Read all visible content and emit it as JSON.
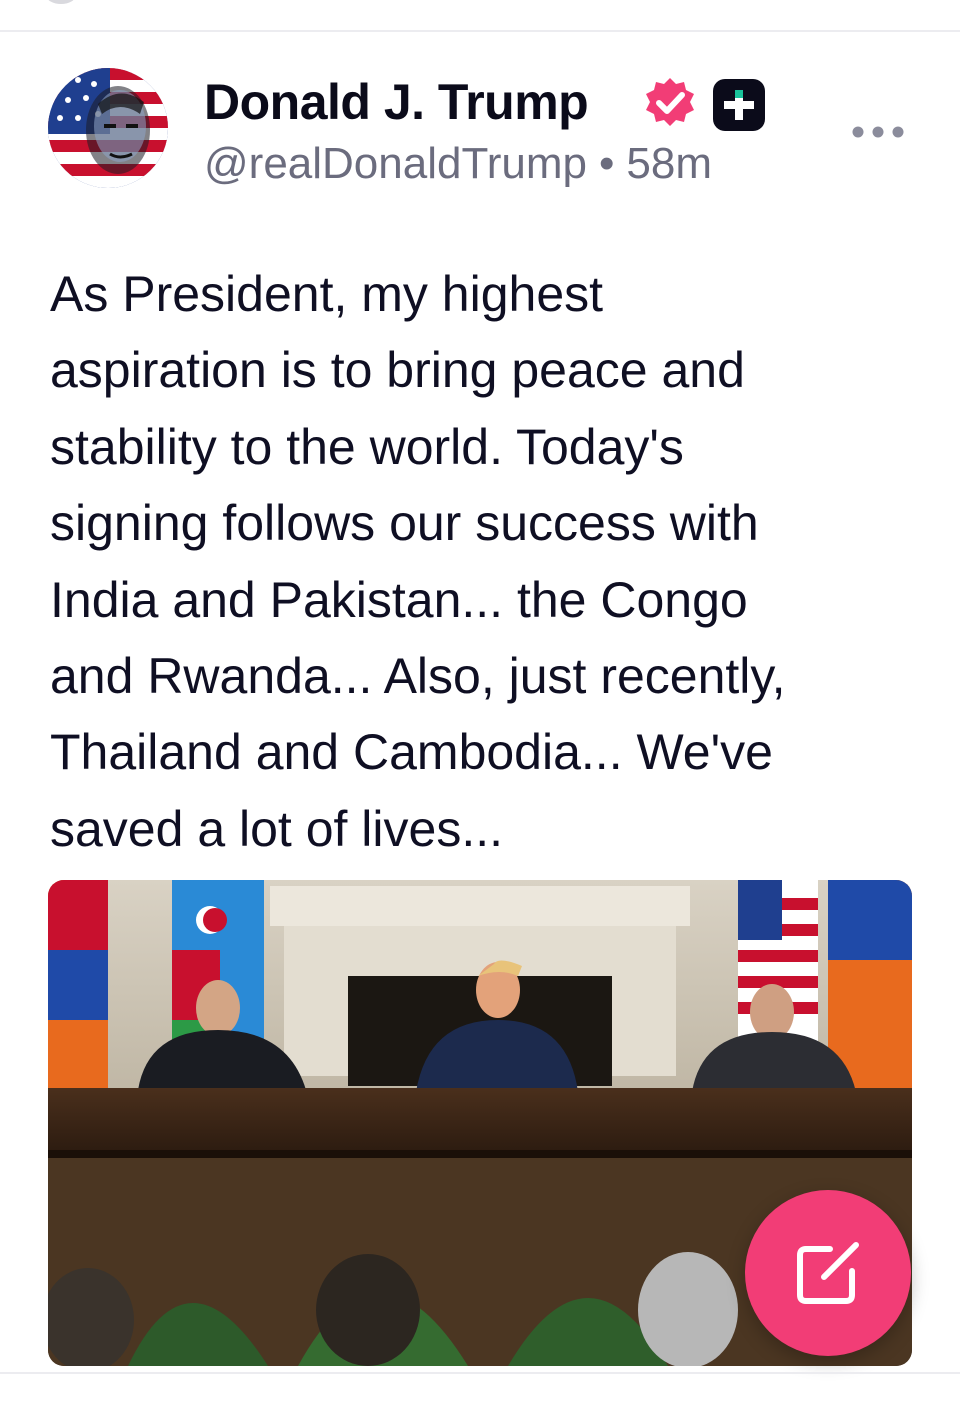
{
  "post": {
    "author_name": "Donald J. Trump",
    "handle": "@realDonaldTrump",
    "separator": "•",
    "time_ago": "58m",
    "text": "As President, my highest\naspiration is to bring peace and\nstability to the world. Today's\nsigning follows our success with\nIndia and Pakistan... the Congo\nand Rwanda... Also, just recently,\nThailand and Cambodia... We've\nsaved a lot of lives...",
    "verified": true
  },
  "icons": {
    "verified": "verified-badge-icon",
    "plus_badge": "plus-badge-icon",
    "more": "more-options-icon",
    "compose": "compose-icon"
  },
  "colors": {
    "verified_badge": "#f23d76",
    "compose_button": "#f23d76",
    "primary_text": "#0f0f23",
    "secondary_text": "#6b6c7e",
    "divider": "#ececf0"
  }
}
